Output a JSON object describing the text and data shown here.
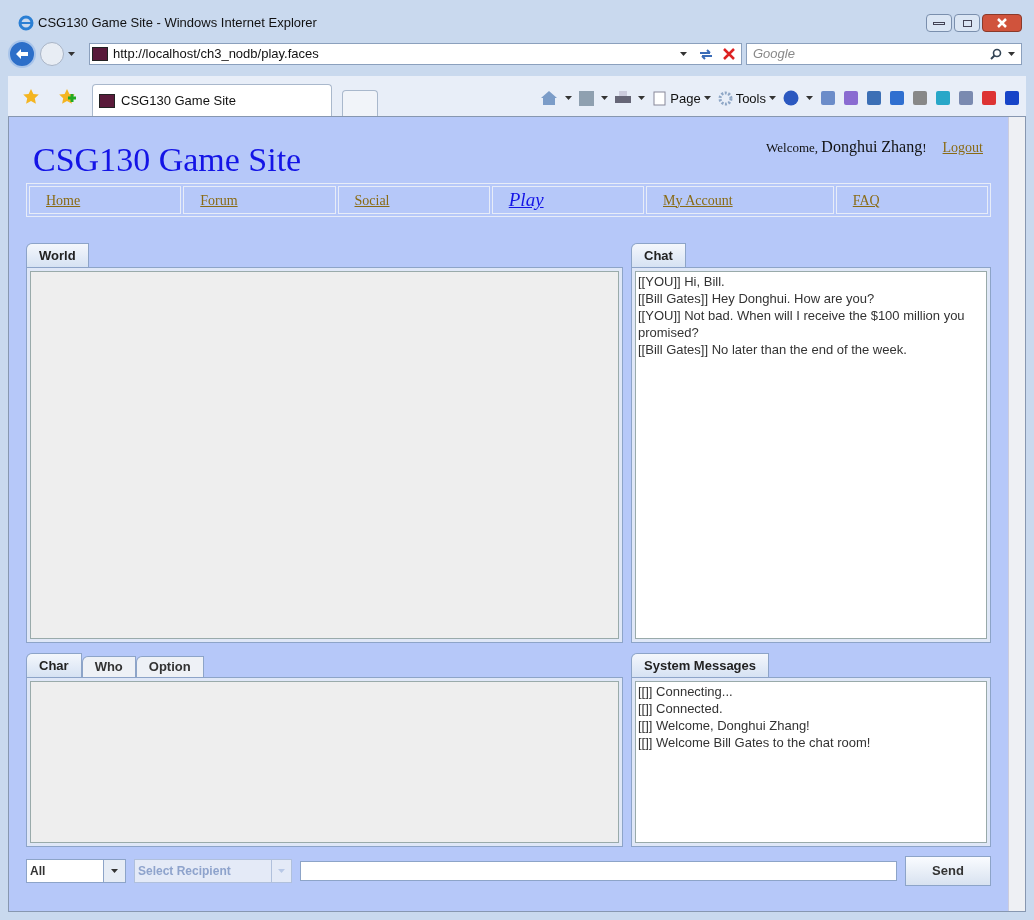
{
  "window": {
    "title": "CSG130 Game Site - Windows Internet Explorer"
  },
  "address_bar": {
    "url": "http://localhost/ch3_nodb/play.faces"
  },
  "search": {
    "placeholder": "Google"
  },
  "browser_tab": {
    "title": "CSG130 Game Site"
  },
  "command_bar": [
    "Page",
    "Tools"
  ],
  "site": {
    "title": "CSG130 Game Site",
    "welcome": "Welcome,",
    "user": "Donghui Zhang",
    "user_suffix": "!",
    "logout": "Logout"
  },
  "nav": [
    {
      "label": "Home",
      "selected": false
    },
    {
      "label": "Forum",
      "selected": false
    },
    {
      "label": "Social",
      "selected": false
    },
    {
      "label": "Play",
      "selected": true
    },
    {
      "label": "My Account",
      "selected": false
    },
    {
      "label": "FAQ",
      "selected": false
    }
  ],
  "world_tabs": [
    {
      "label": "World",
      "selected": true
    }
  ],
  "chat_tabs": [
    {
      "label": "Chat",
      "selected": true
    }
  ],
  "chat_messages": [
    "[[YOU]] Hi, Bill.",
    "[[Bill Gates]] Hey Donghui. How are you?",
    "[[YOU]] Not bad. When will I receive the $100 million you promised?",
    "[[Bill Gates]] No later than the end of the week."
  ],
  "lower_tabs": [
    {
      "label": "Char",
      "selected": true
    },
    {
      "label": "Who",
      "selected": false
    },
    {
      "label": "Option",
      "selected": false
    }
  ],
  "system_tabs": [
    {
      "label": "System Messages",
      "selected": true
    }
  ],
  "system_messages": [
    "[[]] Connecting...",
    "[[]] Connected.",
    "[[]] Welcome, Donghui Zhang!",
    "[[]] Welcome Bill Gates to the chat room!"
  ],
  "compose": {
    "scope": "All",
    "recipient_placeholder": "Select Recipient",
    "recipient_disabled": true,
    "send": "Send"
  }
}
